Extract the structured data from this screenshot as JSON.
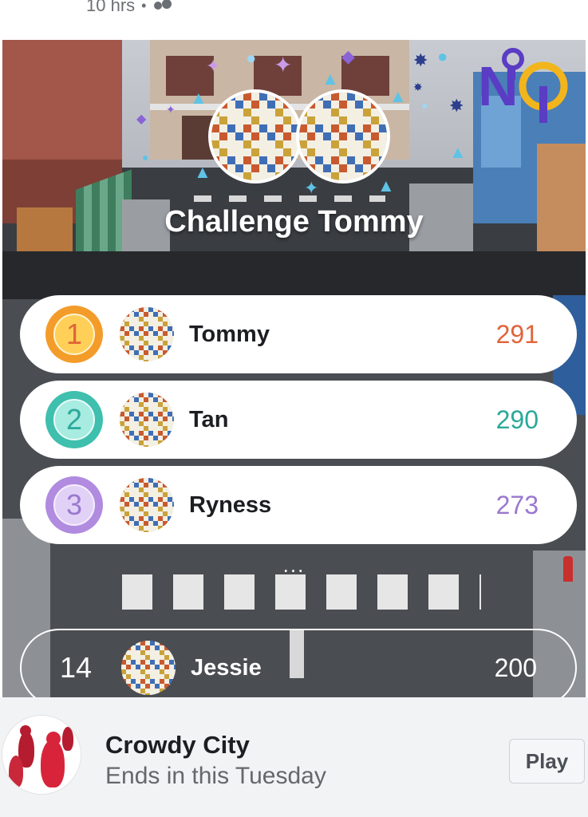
{
  "post_meta": {
    "time": "10 hrs",
    "separator": "•",
    "audience_icon": "friends-icon"
  },
  "banner": {
    "title": "Challenge Tommy",
    "logo_icon": "watermark-logo",
    "leaderboard": [
      {
        "rank": "1",
        "name": "Tommy",
        "score": "291",
        "medal_color": "#f39c2a",
        "score_color": "#e0643a"
      },
      {
        "rank": "2",
        "name": "Tan",
        "score": "290",
        "medal_color": "#3fbfae",
        "score_color": "#2aa99a"
      },
      {
        "rank": "3",
        "name": "Ryness",
        "score": "273",
        "medal_color": "#b08be0",
        "score_color": "#9a78cf"
      }
    ],
    "ellipsis": "...",
    "self": {
      "rank": "14",
      "name": "Jessie",
      "score": "200"
    }
  },
  "footer": {
    "game_name": "Crowdy City",
    "subtitle": "Ends in this Tuesday",
    "play_label": "Play"
  }
}
